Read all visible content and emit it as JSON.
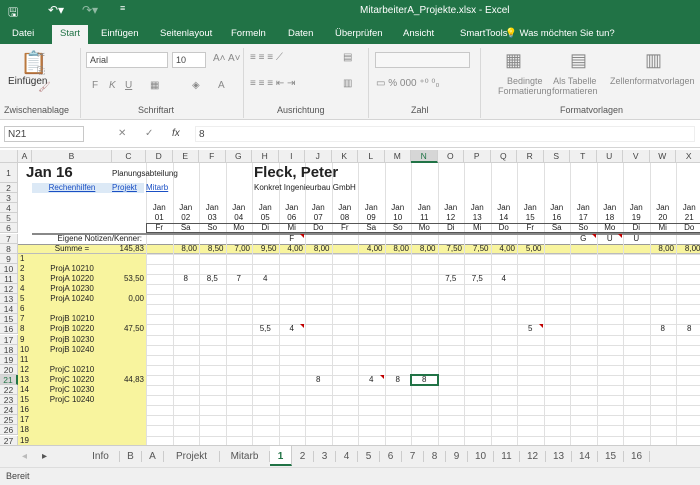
{
  "title": "MitarbeiterA_Projekte.xlsx - Excel",
  "ribbon_tabs": [
    "Datei",
    "Start",
    "Einfügen",
    "Seitenlayout",
    "Formeln",
    "Daten",
    "Überprüfen",
    "Ansicht",
    "SmartTools"
  ],
  "tell_me": "Was möchten Sie tun?",
  "ribbon": {
    "paste": "Einfügen",
    "font": "Arial",
    "size": "10",
    "bold": "F",
    "italic": "K",
    "underline": "U",
    "cond_format_1": "Bedingte",
    "cond_format_2": "Formatierung",
    "as_table_1": "Als Tabelle",
    "as_table_2": "formatieren",
    "cell_styles": "Zellenformatvorlagen",
    "groups": [
      "Zwischenablage",
      "Schriftart",
      "Ausrichtung",
      "Zahl",
      "Formatvorlagen"
    ]
  },
  "formula_bar": {
    "name_box": "N21",
    "fx": "fx",
    "value": "8"
  },
  "columns": [
    "A",
    "B",
    "C",
    "D",
    "E",
    "F",
    "G",
    "H",
    "I",
    "J",
    "K",
    "L",
    "M",
    "N",
    "O",
    "P",
    "Q",
    "R",
    "S",
    "T",
    "U",
    "V",
    "W",
    "X"
  ],
  "selected": {
    "col": "N",
    "row": 21
  },
  "cells": [
    {
      "ref": "B1",
      "v": "Jan 16",
      "s": "big"
    },
    {
      "ref": "C1",
      "v": "Planungsabteilung"
    },
    {
      "ref": "H1",
      "v": "Fleck, Peter",
      "s": "big"
    },
    {
      "ref": "B2",
      "v": "Rechenhilfen",
      "s": "link"
    },
    {
      "ref": "C2",
      "v": "Projekt",
      "s": "link"
    },
    {
      "ref": "C2b",
      "v": "Mitarb",
      "s": "link"
    },
    {
      "ref": "H2",
      "v": "Konkret Ingenieurbau GmbH"
    },
    {
      "ref": "C7",
      "v": "Eigene Notizen/Kenner:",
      "a": "r"
    },
    {
      "ref": "B8",
      "v": "Summe =",
      "a": "c"
    },
    {
      "ref": "C8",
      "v": "145,83",
      "a": "r"
    },
    {
      "ref": "I7",
      "v": "F",
      "a": "c"
    },
    {
      "ref": "T7",
      "v": "G",
      "a": "c"
    },
    {
      "ref": "U7",
      "v": "U",
      "a": "c"
    },
    {
      "ref": "V7",
      "v": "U",
      "a": "c"
    },
    {
      "ref": "E8",
      "v": "8,00",
      "a": "r"
    },
    {
      "ref": "F8",
      "v": "8,50",
      "a": "r"
    },
    {
      "ref": "G8",
      "v": "7,00",
      "a": "r"
    },
    {
      "ref": "H8",
      "v": "9,50",
      "a": "r"
    },
    {
      "ref": "I8",
      "v": "4,00",
      "a": "r"
    },
    {
      "ref": "J8",
      "v": "8,00",
      "a": "r"
    },
    {
      "ref": "L8",
      "v": "4,00",
      "a": "r"
    },
    {
      "ref": "M8",
      "v": "8,00",
      "a": "r"
    },
    {
      "ref": "N8",
      "v": "8,00",
      "a": "r"
    },
    {
      "ref": "O8",
      "v": "7,50",
      "a": "r"
    },
    {
      "ref": "P8",
      "v": "7,50",
      "a": "r"
    },
    {
      "ref": "Q8",
      "v": "4,00",
      "a": "r"
    },
    {
      "ref": "R8",
      "v": "5,00",
      "a": "r"
    },
    {
      "ref": "W8",
      "v": "8,00",
      "a": "r"
    },
    {
      "ref": "X8",
      "v": "8,00",
      "a": "r"
    },
    {
      "ref": "B10",
      "v": "ProjA 10210",
      "a": "c"
    },
    {
      "ref": "B11",
      "v": "ProjA 10220",
      "a": "c"
    },
    {
      "ref": "B12",
      "v": "ProjA 10230",
      "a": "c"
    },
    {
      "ref": "B13",
      "v": "ProjA 10240",
      "a": "c"
    },
    {
      "ref": "B15",
      "v": "ProjB 10210",
      "a": "c"
    },
    {
      "ref": "B16",
      "v": "ProjB 10220",
      "a": "c"
    },
    {
      "ref": "B17",
      "v": "ProjB 10230",
      "a": "c"
    },
    {
      "ref": "B18",
      "v": "ProjB 10240",
      "a": "c"
    },
    {
      "ref": "B20",
      "v": "ProjC 10210",
      "a": "c"
    },
    {
      "ref": "B21",
      "v": "ProjC 10220",
      "a": "c"
    },
    {
      "ref": "B22",
      "v": "ProjC 10230",
      "a": "c"
    },
    {
      "ref": "B23",
      "v": "ProjC 10240",
      "a": "c"
    },
    {
      "ref": "C11",
      "v": "53,50",
      "a": "r"
    },
    {
      "ref": "C13",
      "v": "0,00",
      "a": "r"
    },
    {
      "ref": "C16",
      "v": "47,50",
      "a": "r"
    },
    {
      "ref": "C21",
      "v": "44,83",
      "a": "r"
    },
    {
      "ref": "E11",
      "v": "8",
      "a": "c"
    },
    {
      "ref": "F11",
      "v": "8,5",
      "a": "c"
    },
    {
      "ref": "G11",
      "v": "7",
      "a": "c"
    },
    {
      "ref": "H11",
      "v": "4",
      "a": "c"
    },
    {
      "ref": "O11",
      "v": "7,5",
      "a": "c"
    },
    {
      "ref": "P11",
      "v": "7,5",
      "a": "c"
    },
    {
      "ref": "Q11",
      "v": "4",
      "a": "c"
    },
    {
      "ref": "H16",
      "v": "5,5",
      "a": "c"
    },
    {
      "ref": "I16",
      "v": "4",
      "a": "c"
    },
    {
      "ref": "R16",
      "v": "5",
      "a": "c"
    },
    {
      "ref": "W16",
      "v": "8",
      "a": "c"
    },
    {
      "ref": "X16",
      "v": "8",
      "a": "c"
    },
    {
      "ref": "J21",
      "v": "8",
      "a": "c"
    },
    {
      "ref": "L21",
      "v": "4",
      "a": "c"
    },
    {
      "ref": "M21",
      "v": "8",
      "a": "c"
    },
    {
      "ref": "N21",
      "v": "8",
      "a": "c"
    }
  ],
  "comments": [
    "I7",
    "T7",
    "U7",
    "I16",
    "R16",
    "L21"
  ],
  "day_numbers": [
    "01",
    "02",
    "03",
    "04",
    "05",
    "06",
    "07",
    "08",
    "09",
    "10",
    "11",
    "12",
    "13",
    "14",
    "15",
    "16",
    "17",
    "18",
    "19",
    "20",
    "21"
  ],
  "weekdays": [
    "Fr",
    "Sa",
    "So",
    "Mo",
    "Di",
    "Mi",
    "Do",
    "Fr",
    "Sa",
    "So",
    "Mo",
    "Di",
    "Mi",
    "Do",
    "Fr",
    "Sa",
    "So",
    "Mo",
    "Di",
    "Mi",
    "Do"
  ],
  "month": "Jan",
  "sheet_tabs": [
    "Info",
    "B",
    "A",
    "Projekt",
    "Mitarb",
    "1",
    "2",
    "3",
    "4",
    "5",
    "6",
    "7",
    "8",
    "9",
    "10",
    "11",
    "12",
    "13",
    "14",
    "15",
    "16"
  ],
  "active_sheet": "1",
  "status": "Bereit"
}
